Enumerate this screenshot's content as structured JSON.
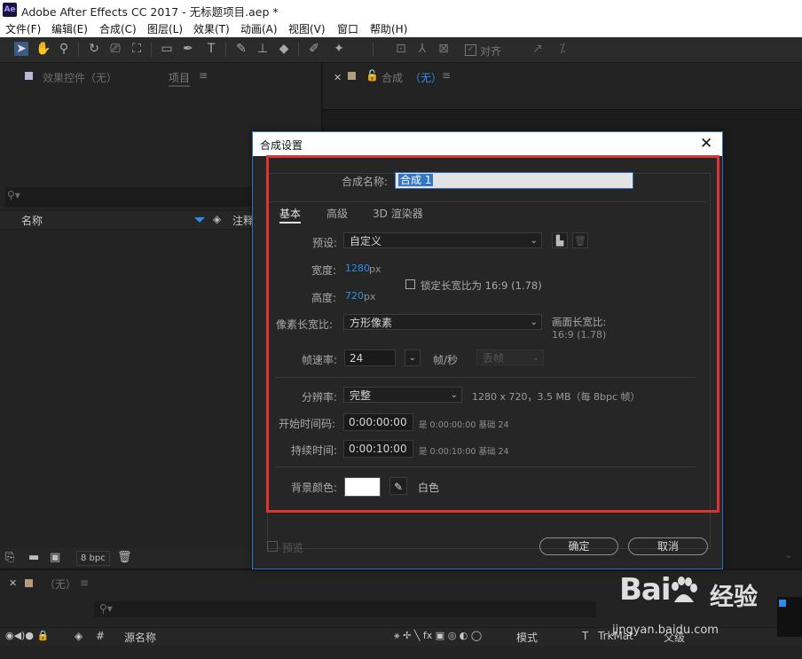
{
  "window": {
    "app_icon": "Ae",
    "title": "Adobe After Effects CC 2017 - 无标题项目.aep *"
  },
  "menubar": [
    "文件(F)",
    "编辑(E)",
    "合成(C)",
    "图层(L)",
    "效果(T)",
    "动画(A)",
    "视图(V)",
    "窗口",
    "帮助(H)"
  ],
  "toolbar": {
    "align_label": "对齐"
  },
  "left_panel": {
    "effects_tab": "效果控件（无）",
    "project_tab": "项目",
    "columns": {
      "name": "名称",
      "comment": "注释"
    },
    "bottom": {
      "bpc": "8 bpc"
    }
  },
  "comp_panel": {
    "tab_label": "合成",
    "tab_value": "（无）"
  },
  "timeline": {
    "tab_value": "（无）",
    "columns": {
      "source_name": "源名称",
      "mode": "模式",
      "t": "T",
      "trkmat": "TrkMat",
      "parent": "父级"
    }
  },
  "dialog": {
    "title": "合成设置",
    "comp_name_label": "合成名称:",
    "comp_name_value": "合成 1",
    "tabs": [
      "基本",
      "高级",
      "3D 渲染器"
    ],
    "preset_label": "预设:",
    "preset_value": "自定义",
    "width_label": "宽度:",
    "width_value": "1280",
    "height_label": "高度:",
    "height_value": "720",
    "px": "px",
    "lock_ratio_label": "锁定长宽比为 16:9 (1.78)",
    "pixel_aspect_label": "像素长宽比:",
    "pixel_aspect_value": "方形像素",
    "frame_aspect_label": "画面长宽比:",
    "frame_aspect_value": "16:9 (1.78)",
    "framerate_label": "帧速率:",
    "framerate_value": "24",
    "fps_unit": "帧/秒",
    "drop_frame_value": "丢帧",
    "resolution_label": "分辨率:",
    "resolution_value": "完整",
    "resolution_info": "1280 x 720，3.5 MB（每 8bpc 帧）",
    "start_tc_label": "开始时间码:",
    "start_tc_value": "0:00:00:00",
    "start_tc_info": "是 0:00:00:00  基础 24",
    "duration_label": "持续时间:",
    "duration_value": "0:00:10:00",
    "duration_info": "是 0:00:10:00  基础 24",
    "bg_color_label": "背景颜色:",
    "bg_color_hex": "#FFFFFF",
    "bg_color_name": "白色",
    "preview_label": "预览",
    "ok_label": "确定",
    "cancel_label": "取消"
  },
  "watermark": {
    "logo": "Bai",
    "text": "经验",
    "url": "jingyan.baidu.com"
  },
  "colors": {
    "accent_blue": "#2D8CEB",
    "annotation_red": "#E03232"
  }
}
